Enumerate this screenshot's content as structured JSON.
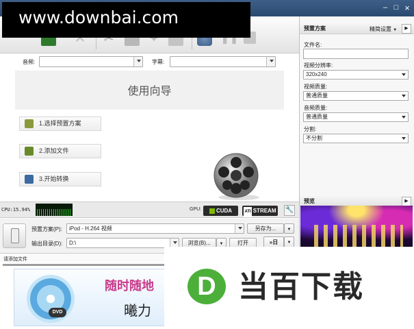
{
  "watermark": "www.downbai.com",
  "titlebar": {
    "minimize": "–",
    "maximize": "□",
    "close": "×"
  },
  "tracks": {
    "audio_label": "音频:",
    "subtitle_label": "字幕:",
    "audio_value": "",
    "subtitle_value": ""
  },
  "guide": {
    "title": "使用向导",
    "steps": [
      "1.选择预置方案",
      "2.添加文件",
      "3.开始转换"
    ]
  },
  "status": {
    "cpu": "CPU:15.94%",
    "gpu_label": "GPU:",
    "cuda": "CUDA",
    "ati": "STREAM"
  },
  "output": {
    "preset_label": "预置方案(P):",
    "preset_value": "iPod - H.264 视频",
    "save_as": "另存为...",
    "dir_label": "输出目录(D):",
    "dir_value": "D:\\",
    "browse": "浏览(B)...",
    "open": "打开",
    "convert": "»日"
  },
  "files_label": "请添加文件",
  "right": {
    "header": "预置方案",
    "mode": "精简设置",
    "filename_label": "文件名:",
    "filename_value": "",
    "resolution_label": "视频分辨率:",
    "resolution_value": "320x240",
    "vquality_label": "视频质量:",
    "vquality_value": "普通质量",
    "aquality_label": "音频质量:",
    "aquality_value": "普通质量",
    "split_label": "分割:",
    "split_value": "不分割",
    "preview_header": "预览"
  },
  "ad": {
    "line1": "随时随地",
    "line2": "曦力",
    "dvd": "DVD",
    "brand": "当百下载",
    "logo_letter": "D"
  }
}
